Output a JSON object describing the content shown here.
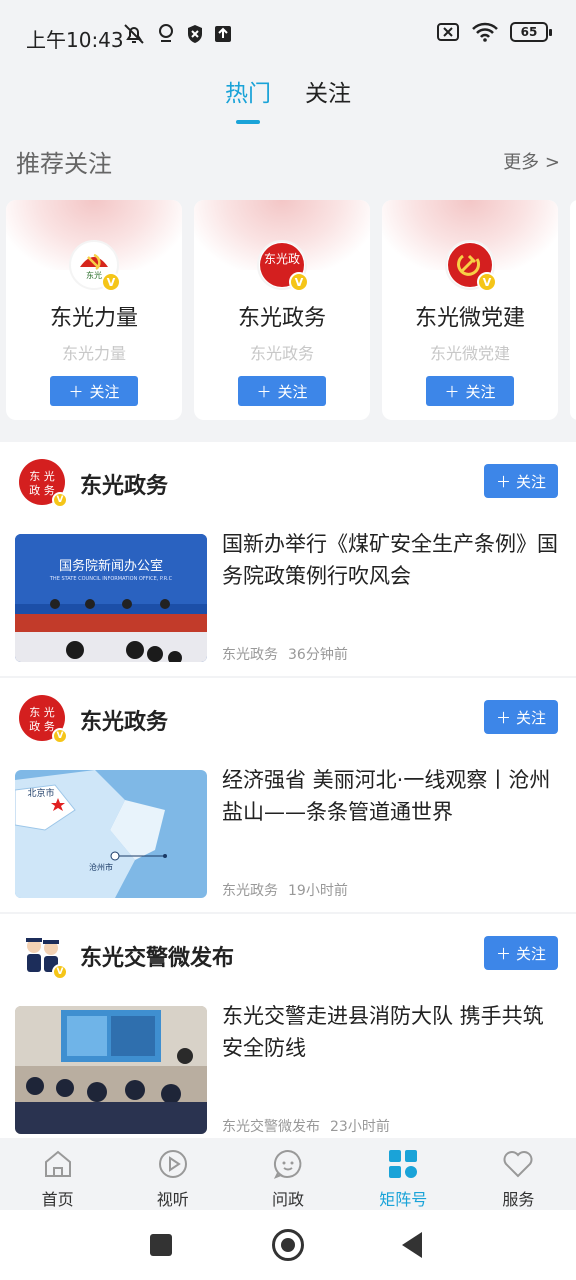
{
  "status_bar": {
    "time": "上午10:43",
    "battery": "65"
  },
  "top_tabs": [
    {
      "label": "热门",
      "active": true
    },
    {
      "label": "关注",
      "active": false
    }
  ],
  "recommend": {
    "title": "推荐关注",
    "more": "更多 >",
    "cards": [
      {
        "name": "东光力量",
        "sub": "东光力量",
        "follow": "关注",
        "avatar_text": "东光"
      },
      {
        "name": "东光政务",
        "sub": "东光政务",
        "follow": "关注",
        "avatar_text": "东光政"
      },
      {
        "name": "东光微党建",
        "sub": "东光微党建",
        "follow": "关注",
        "avatar_text": ""
      }
    ]
  },
  "feed": [
    {
      "source": "东光政务",
      "follow": "关注",
      "title": "国新办举行《煤矿安全生产条例》国务院政策例行吹风会",
      "meta_source": "东光政务",
      "time": "36分钟前",
      "thumb_caption": "国务院新闻办公室",
      "thumb_subcaption": "THE STATE COUNCIL INFORMATION OFFICE, P.R.C"
    },
    {
      "source": "东光政务",
      "follow": "关注",
      "title": "经济强省 美丽河北·一线观察丨沧州盐山——条条管道通世界",
      "meta_source": "东光政务",
      "time": "19小时前",
      "map_label_1": "北京市",
      "map_label_2": "沧州市"
    },
    {
      "source": "东光交警微发布",
      "follow": "关注",
      "title": "东光交警走进县消防大队 携手共筑安全防线",
      "meta_source": "东光交警微发布",
      "time": "23小时前"
    }
  ],
  "bottom_nav": [
    {
      "label": "首页",
      "icon": "home-icon",
      "active": false
    },
    {
      "label": "视听",
      "icon": "play-icon",
      "active": false
    },
    {
      "label": "问政",
      "icon": "chat-icon",
      "active": false
    },
    {
      "label": "矩阵号",
      "icon": "grid-icon",
      "active": true
    },
    {
      "label": "服务",
      "icon": "heart-icon",
      "active": false
    }
  ],
  "colors": {
    "accent": "#1aa3d8",
    "follow_button": "#3d86e8",
    "badge": "#f5c518"
  }
}
